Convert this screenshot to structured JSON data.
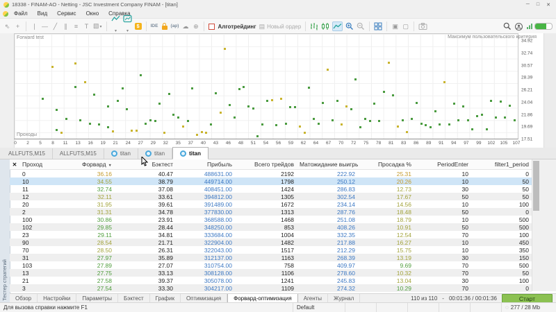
{
  "window": {
    "title": "18338 - FINAM-AO - Netting - JSC Investment Company FINAM - [titan]",
    "controls": [
      "─",
      "□",
      "✕"
    ]
  },
  "menu": {
    "items": [
      "Файл",
      "Вид",
      "Сервис",
      "Окно",
      "Справка"
    ]
  },
  "toolbar": {
    "items": [
      {
        "name": "cursor-icon",
        "kind": "glyph",
        "glyph": "⇖"
      },
      {
        "name": "crosshair-icon",
        "kind": "glyph",
        "glyph": "+"
      },
      {
        "kind": "sep"
      },
      {
        "name": "vertical-line-icon",
        "kind": "glyph",
        "glyph": "∣"
      },
      {
        "name": "horizontal-line-icon",
        "kind": "glyph",
        "glyph": "―"
      },
      {
        "name": "trendline-icon",
        "kind": "glyph",
        "glyph": "╱"
      },
      {
        "name": "channel-icon",
        "kind": "glyph",
        "glyph": "∥"
      },
      {
        "name": "fibonacci-icon",
        "kind": "glyph",
        "glyph": "≡"
      },
      {
        "name": "text-tool-icon",
        "kind": "glyph",
        "glyph": "T"
      },
      {
        "name": "shapes-icon",
        "kind": "glyph",
        "glyph": "▧",
        "dropdown": true
      },
      {
        "kind": "sep"
      },
      {
        "name": "chart-line-style-icon",
        "kind": "svg",
        "svg": "zigzag",
        "dropdown": true
      },
      {
        "name": "indicators-icon",
        "kind": "svg",
        "svg": "indicator",
        "dropdown": true
      },
      {
        "name": "symbols-icon",
        "kind": "coin",
        "glyph": "$"
      },
      {
        "kind": "sep"
      },
      {
        "name": "metaeditor-ide-icon",
        "kind": "text",
        "glyph": "IDE"
      },
      {
        "name": "lock-icon",
        "kind": "lock"
      },
      {
        "name": "api-icon",
        "kind": "text",
        "glyph": "(ap)"
      },
      {
        "name": "cloud-icon",
        "kind": "glyph",
        "glyph": "☁"
      },
      {
        "name": "globe-icon",
        "kind": "glyph",
        "glyph": "⊕"
      },
      {
        "kind": "sep"
      },
      {
        "name": "algotrading-toggle",
        "kind": "algo",
        "label": "Алготрейдинг"
      },
      {
        "name": "new-order-button",
        "kind": "neworder",
        "label": "Новый ордер"
      },
      {
        "kind": "sep"
      },
      {
        "name": "bars-chart-icon",
        "kind": "svg",
        "svg": "bars"
      },
      {
        "name": "candles-chart-icon",
        "kind": "svg",
        "svg": "candles"
      },
      {
        "name": "line-chart-icon",
        "kind": "svg",
        "svg": "line",
        "selected": true
      },
      {
        "name": "zoom-in-icon",
        "kind": "svg",
        "svg": "zoomin"
      },
      {
        "name": "zoom-out-icon",
        "kind": "svg",
        "svg": "zoomout"
      },
      {
        "kind": "sep"
      },
      {
        "name": "tile-windows-icon",
        "kind": "svg",
        "svg": "grid"
      },
      {
        "kind": "sep"
      },
      {
        "name": "dock-window-icon",
        "kind": "glyph",
        "glyph": "▣"
      },
      {
        "name": "undock-window-icon",
        "kind": "glyph",
        "glyph": "▢"
      },
      {
        "kind": "sep"
      },
      {
        "name": "camera-icon",
        "kind": "svg",
        "svg": "camera"
      },
      {
        "kind": "spacer"
      },
      {
        "name": "search-icon",
        "kind": "svg",
        "svg": "search"
      },
      {
        "name": "profile-icon",
        "kind": "svg",
        "svg": "profile"
      },
      {
        "name": "connection-status-icon",
        "kind": "signal"
      }
    ]
  },
  "chart": {
    "top_left_label": "Forward test",
    "top_right_label": "Максимум пользовательского критерия",
    "bottom_left_label": "Проходы",
    "y_ticks": [
      "34.92",
      "32.74",
      "30.57",
      "28.39",
      "26.21",
      "24.04",
      "21.86",
      "19.69",
      "17.51"
    ],
    "x_ticks": [
      "0",
      "2",
      "5",
      "8",
      "11",
      "13",
      "16",
      "19",
      "21",
      "24",
      "27",
      "29",
      "32",
      "35",
      "37",
      "40",
      "43",
      "46",
      "48",
      "51",
      "54",
      "56",
      "59",
      "62",
      "64",
      "67",
      "70",
      "72",
      "75",
      "78",
      "81",
      "83",
      "86",
      "89",
      "91",
      "94",
      "97",
      "99",
      "102",
      "105",
      "107"
    ],
    "y_range": [
      17.5,
      36.3
    ],
    "x_range": [
      0,
      107
    ],
    "colors": {
      "green": "#4a9b3f",
      "yellow": "#c9b42e"
    },
    "points": [
      [
        6,
        24.7,
        "g"
      ],
      [
        8,
        30.4,
        "y"
      ],
      [
        9,
        22.7,
        "g"
      ],
      [
        9,
        19.1,
        "g"
      ],
      [
        10,
        18.6,
        "y"
      ],
      [
        11,
        21.1,
        "g"
      ],
      [
        13,
        31.1,
        "y"
      ],
      [
        13,
        26.9,
        "g"
      ],
      [
        14,
        20.8,
        "g"
      ],
      [
        15,
        27.7,
        "y"
      ],
      [
        16,
        20.3,
        "g"
      ],
      [
        17,
        25.5,
        "g"
      ],
      [
        18,
        20.1,
        "g"
      ],
      [
        20,
        19.6,
        "g"
      ],
      [
        20,
        23.3,
        "g"
      ],
      [
        21,
        18.9,
        "y"
      ],
      [
        22,
        24.3,
        "g"
      ],
      [
        23,
        26.6,
        "g"
      ],
      [
        24,
        22.8,
        "g"
      ],
      [
        25,
        19.0,
        "y"
      ],
      [
        26,
        19.0,
        "y"
      ],
      [
        27,
        28.9,
        "g"
      ],
      [
        28,
        20.3,
        "g"
      ],
      [
        29,
        20.9,
        "g"
      ],
      [
        30,
        20.7,
        "g"
      ],
      [
        31,
        23.9,
        "g"
      ],
      [
        32,
        18.6,
        "y"
      ],
      [
        33,
        25.6,
        "g"
      ],
      [
        34,
        21.9,
        "g"
      ],
      [
        35,
        21.3,
        "g"
      ],
      [
        36,
        19.7,
        "y"
      ],
      [
        37,
        20.7,
        "g"
      ],
      [
        38,
        26.6,
        "g"
      ],
      [
        39,
        18.2,
        "y"
      ],
      [
        40,
        18.7,
        "y"
      ],
      [
        41,
        18.6,
        "y"
      ],
      [
        42,
        20.1,
        "g"
      ],
      [
        43,
        25.7,
        "g"
      ],
      [
        44,
        22.2,
        "y"
      ],
      [
        45,
        33.7,
        "y"
      ],
      [
        46,
        23.6,
        "g"
      ],
      [
        47,
        21.3,
        "g"
      ],
      [
        48,
        26.5,
        "g"
      ],
      [
        49,
        26.8,
        "g"
      ],
      [
        50,
        23.4,
        "g"
      ],
      [
        51,
        23.0,
        "g"
      ],
      [
        52,
        18.0,
        "g"
      ],
      [
        53,
        20.1,
        "g"
      ],
      [
        54,
        24.4,
        "g"
      ],
      [
        55,
        24.5,
        "y"
      ],
      [
        56,
        20.0,
        "g"
      ],
      [
        57,
        24.7,
        "y"
      ],
      [
        58,
        20.3,
        "g"
      ],
      [
        59,
        23.2,
        "g"
      ],
      [
        60,
        23.2,
        "g"
      ],
      [
        61,
        19.8,
        "y"
      ],
      [
        62,
        18.6,
        "y"
      ],
      [
        63,
        26.7,
        "g"
      ],
      [
        64,
        21.1,
        "g"
      ],
      [
        65,
        20.3,
        "g"
      ],
      [
        66,
        24.0,
        "g"
      ],
      [
        67,
        30.0,
        "y"
      ],
      [
        68,
        20.9,
        "g"
      ],
      [
        69,
        24.4,
        "g"
      ],
      [
        70,
        20.1,
        "y"
      ],
      [
        71,
        23.4,
        "y"
      ],
      [
        72,
        22.8,
        "g"
      ],
      [
        73,
        28.2,
        "g"
      ],
      [
        74,
        19.6,
        "g"
      ],
      [
        75,
        21.1,
        "g"
      ],
      [
        76,
        20.7,
        "g"
      ],
      [
        77,
        23.8,
        "g"
      ],
      [
        78,
        20.7,
        "g"
      ],
      [
        79,
        26.0,
        "g"
      ],
      [
        80,
        31.2,
        "y"
      ],
      [
        81,
        25.4,
        "g"
      ],
      [
        82,
        19.8,
        "y"
      ],
      [
        83,
        20.9,
        "g"
      ],
      [
        84,
        18.7,
        "y"
      ],
      [
        85,
        21.1,
        "g"
      ],
      [
        86,
        24.0,
        "g"
      ],
      [
        87,
        20.2,
        "g"
      ],
      [
        88,
        20.0,
        "g"
      ],
      [
        89,
        19.6,
        "g"
      ],
      [
        90,
        22.5,
        "g"
      ],
      [
        91,
        20.1,
        "g"
      ],
      [
        92,
        27.7,
        "y"
      ],
      [
        93,
        20.1,
        "g"
      ],
      [
        94,
        23.8,
        "g"
      ],
      [
        95,
        20.8,
        "g"
      ],
      [
        96,
        23.4,
        "g"
      ],
      [
        97,
        20.8,
        "g"
      ],
      [
        98,
        19.3,
        "g"
      ],
      [
        99,
        21.6,
        "g"
      ],
      [
        100,
        21.8,
        "g"
      ],
      [
        101,
        19.3,
        "g"
      ],
      [
        102,
        24.4,
        "g"
      ],
      [
        103,
        21.4,
        "g"
      ],
      [
        104,
        24.2,
        "g"
      ],
      [
        105,
        21.3,
        "g"
      ],
      [
        106,
        23.5,
        "g"
      ],
      [
        107,
        20.8,
        "g"
      ]
    ]
  },
  "chart_tabs": [
    {
      "label": "ALLFUTS,M15",
      "icon": "chart",
      "active": false
    },
    {
      "label": "ALLFUTS,M15",
      "icon": "chart",
      "active": false
    },
    {
      "label": "titan",
      "icon": "ea",
      "active": false
    },
    {
      "label": "titan",
      "icon": "ea",
      "active": false
    },
    {
      "label": "titan",
      "icon": "ea",
      "active": true
    }
  ],
  "tester": {
    "side_label": "Тестер стратегий",
    "table": {
      "gutter_icon": "✕",
      "sort_indicator": "▼",
      "columns": [
        {
          "key": "pass",
          "label": "Проход",
          "align": "l",
          "width": 67
        },
        {
          "key": "forward",
          "label": "Форвард",
          "align": "r",
          "width": 70,
          "sorted": true
        },
        {
          "key": "backtest",
          "label": "Бэктест",
          "align": "r",
          "width": 88
        },
        {
          "key": "profit",
          "label": "Прибыль",
          "align": "r",
          "width": 85
        },
        {
          "key": "trades",
          "label": "Всего трейдов",
          "align": "r",
          "width": 89
        },
        {
          "key": "expectancy",
          "label": "Матожидание выигрыша",
          "align": "r",
          "width": 88
        },
        {
          "key": "drawdown",
          "label": "Просадка %",
          "align": "r",
          "width": 81
        },
        {
          "key": "period_enter",
          "label": "PeriodEnter",
          "align": "r",
          "width": 82
        },
        {
          "key": "filter1_period",
          "label": "filter1_period",
          "align": "r",
          "width": 87
        }
      ],
      "rows": [
        {
          "pass": "0",
          "forward": "36.16",
          "fwd_c": "gold",
          "backtest": "40.47",
          "profit": "488631.00",
          "trades": "2192",
          "expectancy": "222.92",
          "drawdown": "25.31",
          "dd_c": "gold",
          "period_enter": "10",
          "filter1_period": "0",
          "selected": false
        },
        {
          "pass": "10",
          "forward": "34.55",
          "fwd_c": "olive",
          "backtest": "38.79",
          "profit": "449714.00",
          "trades": "1798",
          "expectancy": "250.12",
          "drawdown": "20.26",
          "dd_c": "gold",
          "period_enter": "10",
          "filter1_period": "50",
          "selected": true
        },
        {
          "pass": "11",
          "forward": "32.74",
          "fwd_c": "green",
          "backtest": "37.08",
          "profit": "408451.00",
          "trades": "1424",
          "expectancy": "286.83",
          "drawdown": "12.73",
          "dd_c": "olive",
          "period_enter": "30",
          "filter1_period": "50",
          "selected": false
        },
        {
          "pass": "12",
          "forward": "32.11",
          "fwd_c": "olive",
          "backtest": "33.61",
          "profit": "394812.00",
          "trades": "1305",
          "expectancy": "302.54",
          "drawdown": "17.67",
          "dd_c": "olive",
          "period_enter": "50",
          "filter1_period": "50",
          "selected": false
        },
        {
          "pass": "20",
          "forward": "31.95",
          "fwd_c": "olive",
          "backtest": "39.61",
          "profit": "391489.00",
          "trades": "1672",
          "expectancy": "234.14",
          "drawdown": "14.56",
          "dd_c": "olive",
          "period_enter": "10",
          "filter1_period": "100",
          "selected": false
        },
        {
          "pass": "2",
          "forward": "31.31",
          "fwd_c": "olive",
          "backtest": "34.78",
          "profit": "377830.00",
          "trades": "1313",
          "expectancy": "287.76",
          "drawdown": "18.48",
          "dd_c": "olive",
          "period_enter": "50",
          "filter1_period": "0",
          "selected": false
        },
        {
          "pass": "100",
          "forward": "30.86",
          "fwd_c": "green",
          "backtest": "23.91",
          "profit": "368588.00",
          "trades": "1468",
          "expectancy": "251.08",
          "drawdown": "18.79",
          "dd_c": "olive",
          "period_enter": "10",
          "filter1_period": "500",
          "selected": false
        },
        {
          "pass": "102",
          "forward": "29.85",
          "fwd_c": "green",
          "backtest": "28.44",
          "profit": "348250.00",
          "trades": "853",
          "expectancy": "408.26",
          "drawdown": "10.91",
          "dd_c": "olive",
          "period_enter": "50",
          "filter1_period": "500",
          "selected": false
        },
        {
          "pass": "23",
          "forward": "29.11",
          "fwd_c": "green",
          "backtest": "34.81",
          "profit": "333684.00",
          "trades": "1004",
          "expectancy": "332.35",
          "drawdown": "12.54",
          "dd_c": "olive",
          "period_enter": "70",
          "filter1_period": "100",
          "selected": false
        },
        {
          "pass": "90",
          "forward": "28.54",
          "fwd_c": "olive",
          "backtest": "21.71",
          "profit": "322904.00",
          "trades": "1482",
          "expectancy": "217.88",
          "drawdown": "16.27",
          "dd_c": "olive",
          "period_enter": "10",
          "filter1_period": "450",
          "selected": false
        },
        {
          "pass": "70",
          "forward": "28.50",
          "fwd_c": "olive",
          "backtest": "26.31",
          "profit": "322043.00",
          "trades": "1517",
          "expectancy": "212.29",
          "drawdown": "15.75",
          "dd_c": "olive",
          "period_enter": "10",
          "filter1_period": "350",
          "selected": false
        },
        {
          "pass": "31",
          "forward": "27.97",
          "fwd_c": "green",
          "backtest": "35.89",
          "profit": "312137.00",
          "trades": "1163",
          "expectancy": "268.39",
          "drawdown": "13.19",
          "dd_c": "olive",
          "period_enter": "30",
          "filter1_period": "150",
          "selected": false
        },
        {
          "pass": "103",
          "forward": "27.89",
          "fwd_c": "green",
          "backtest": "27.07",
          "profit": "310754.00",
          "trades": "758",
          "expectancy": "409.97",
          "drawdown": "9.69",
          "dd_c": "green",
          "period_enter": "70",
          "filter1_period": "500",
          "selected": false
        },
        {
          "pass": "13",
          "forward": "27.75",
          "fwd_c": "green",
          "backtest": "33.13",
          "profit": "308128.00",
          "trades": "1106",
          "expectancy": "278.60",
          "drawdown": "10.32",
          "dd_c": "olive",
          "period_enter": "70",
          "filter1_period": "50",
          "selected": false
        },
        {
          "pass": "21",
          "forward": "27.58",
          "fwd_c": "green",
          "backtest": "39.37",
          "profit": "305078.00",
          "trades": "1241",
          "expectancy": "245.83",
          "drawdown": "13.04",
          "dd_c": "olive",
          "period_enter": "30",
          "filter1_period": "100",
          "selected": false
        },
        {
          "pass": "3",
          "forward": "27.54",
          "fwd_c": "green",
          "backtest": "33.30",
          "profit": "304217.00",
          "trades": "1109",
          "expectancy": "274.32",
          "drawdown": "10.29",
          "dd_c": "green",
          "period_enter": "70",
          "filter1_period": "0",
          "selected": false
        }
      ]
    },
    "tabs": [
      "Обзор",
      "Настройки",
      "Параметры",
      "Бэктест",
      "График",
      "Оптимизация",
      "Форвард-оптимизация",
      "Агенты",
      "Журнал"
    ],
    "active_tab": "Форвард-оптимизация",
    "status": {
      "progress": "110 из 110",
      "dash": "-",
      "time": "00:01:36 / 00:01:36",
      "start_label": "Старт"
    }
  },
  "status_bar": {
    "help": "Для вызова справки нажмите F1",
    "profile": "Default",
    "spinner": "◌",
    "memory": "277 / 28 Mb"
  }
}
